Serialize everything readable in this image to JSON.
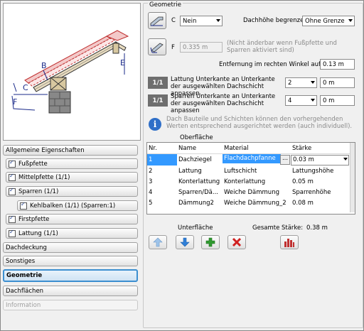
{
  "left_nav": {
    "items": [
      {
        "label": "Allgemeine Eigenschaften"
      },
      {
        "label": "Fußpfette"
      },
      {
        "label": "Mittelpfette (1/1)"
      },
      {
        "label": "Sparren (1/1)"
      },
      {
        "label": "Kehlbalken (1/1) (Sparren:1)"
      },
      {
        "label": "Firstpfette"
      },
      {
        "label": "Lattung (1/1)"
      },
      {
        "label": "Dachdeckung"
      },
      {
        "label": "Sonstiges"
      },
      {
        "label": "Geometrie"
      },
      {
        "label": "Dachflächen"
      },
      {
        "label": "Information"
      }
    ]
  },
  "preview": {
    "labels": [
      "B",
      "C",
      "E",
      "F"
    ]
  },
  "geometrie": {
    "group_title": "Geometrie",
    "c_label": "C",
    "c_value": "Nein",
    "dachhoehe_label": "Dachhöhe begrenzen",
    "dachhoehe_value": "Ohne Grenze",
    "f_label": "F",
    "f_value": "0.335 m",
    "f_note": "(Nicht änderbar wenn Fußpfette und Sparren aktiviert sind)",
    "entfernung_label": "Entfernung im rechten Winkel auf (B)",
    "entfernung_value": "0.13 m",
    "badge": "1/1",
    "lattung_label": "Lattung Unterkante an Unterkante der ausgewählten Dachschicht anpassen",
    "lattung_combo": "2",
    "lattung_value": "0 m",
    "sparren_label": "Sparren Unterkante an Unterkante der ausgewählten Dachschicht anpassen",
    "sparren_combo": "4",
    "sparren_value": "0 m",
    "info_text": "Dach Bauteile und Schichten können den vorhergehenden Werten entsprechend ausgerichtet werden (auch individuell)."
  },
  "oberflaeche": {
    "title": "Oberfläche",
    "columns": [
      "Nr.",
      "Name",
      "Material",
      "Stärke"
    ],
    "rows": [
      {
        "nr": "1",
        "name": "Dachziegel",
        "material": "Flachdachpfanne",
        "staerke": "0.03 m"
      },
      {
        "nr": "2",
        "name": "Lattung",
        "material": "Luftschicht",
        "staerke": "Lattungshöhe"
      },
      {
        "nr": "3",
        "name": "Konterlattung",
        "material": "Konterlattung",
        "staerke": "0.05 m"
      },
      {
        "nr": "4",
        "name": "Sparren/Dä...",
        "material": "Weiche Dämmung",
        "staerke": "Sparrenhöhe"
      },
      {
        "nr": "5",
        "name": "Dämmung2",
        "material": "Weiche Dämmung_2",
        "staerke": "0.08 m"
      }
    ],
    "ellipsis": "...",
    "unterflaeche_label": "Unterfläche",
    "gesamt_label": "Gesamte Stärke:",
    "gesamt_value": "0.38 m"
  },
  "colors": {
    "selected_row": "#3399ff",
    "accent": "#3c8fd0",
    "add": "#2f9a2f",
    "delete": "#d02020"
  },
  "icons": [
    "arrow-up-icon",
    "arrow-down-icon",
    "add-icon",
    "delete-icon",
    "chart-icon",
    "info-icon"
  ]
}
